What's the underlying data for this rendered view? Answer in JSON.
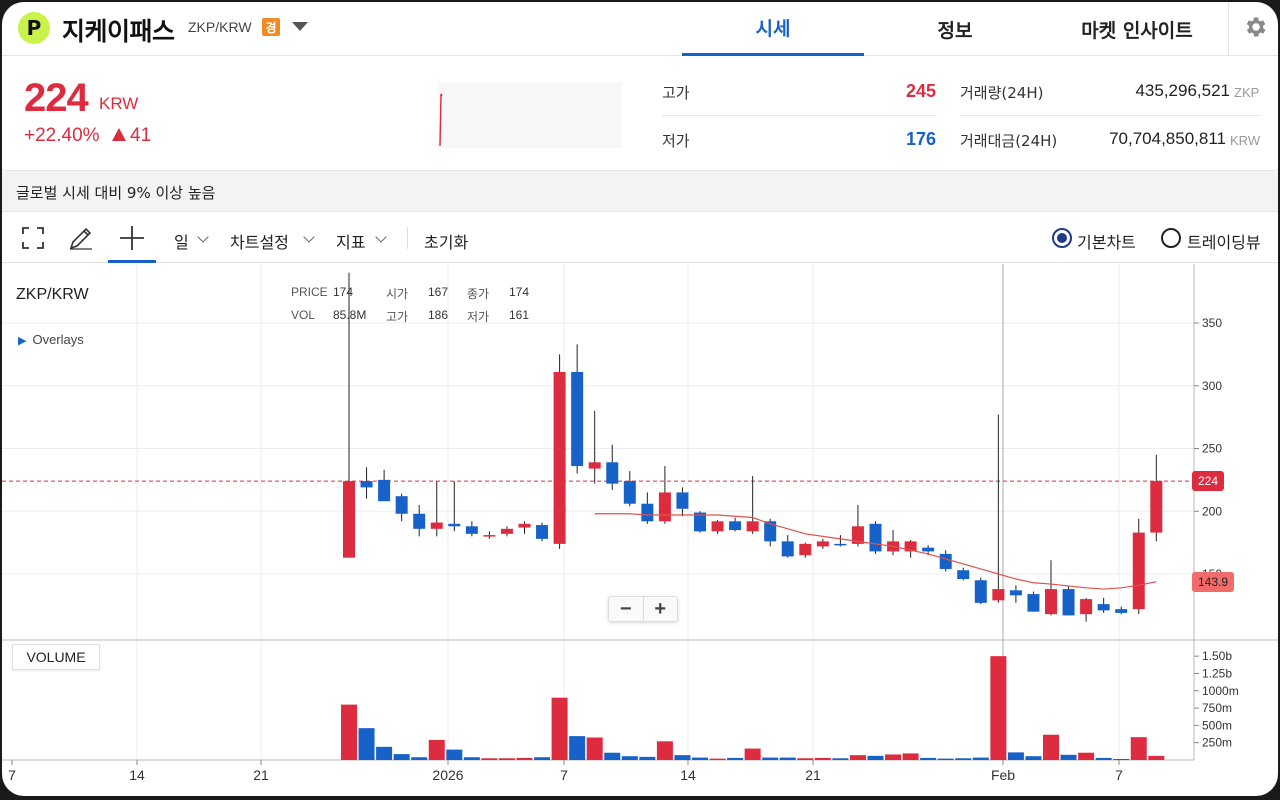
{
  "header": {
    "logo_letter": "P",
    "coin_name": "지케이패스",
    "pair": "ZKP/KRW",
    "warning_badge": "경",
    "tabs": [
      {
        "label": "시세",
        "active": true
      },
      {
        "label": "정보",
        "active": false
      },
      {
        "label": "마켓 인사이트",
        "active": false
      }
    ]
  },
  "price": {
    "current": "224",
    "unit": "KRW",
    "change_pct": "+22.40%",
    "change_abs": "41",
    "color_up": "#dd2c3f",
    "color_down": "#1662c9"
  },
  "stats": {
    "high_label": "고가",
    "high_value": "245",
    "low_label": "저가",
    "low_value": "176",
    "volume_label": "거래량(24H)",
    "volume_value": "435,296,521",
    "volume_unit": "ZKP",
    "amount_label": "거래대금(24H)",
    "amount_value": "70,704,850,811",
    "amount_unit": "KRW"
  },
  "notice": "글로벌 시세 대비 9% 이상 높음",
  "toolbar": {
    "icons": [
      "fullscreen-icon",
      "pencil-icon",
      "crosshair-icon"
    ],
    "interval": "일",
    "chart_settings": "차트설정",
    "indicators": "지표",
    "reset": "초기화",
    "radio_basic": "기본차트",
    "radio_trading": "트레이딩뷰"
  },
  "chart_header": {
    "symbol": "ZKP/KRW",
    "overlays": "Overlays",
    "price_label": "PRICE",
    "price_value": "174",
    "open_label": "시가",
    "open_value": "167",
    "close_label": "종가",
    "close_value": "174",
    "vol_label": "VOL",
    "vol_value": "85.8M",
    "high_label": "고가",
    "high_value": "186",
    "low_label": "저가",
    "low_value": "161"
  },
  "volume_label": "VOLUME",
  "zoom": {
    "minus": "−",
    "plus": "+"
  },
  "chart_data": {
    "type": "candlestick",
    "price_axis": {
      "ticks": [
        150,
        200,
        250,
        300,
        350
      ],
      "ylim": [
        130,
        390
      ]
    },
    "volume_axis": {
      "ticks": [
        "250m",
        "500m",
        "750m",
        "1000m",
        "1.25b",
        "1.50b"
      ]
    },
    "x_ticks": [
      "7",
      "14",
      "21",
      "2026",
      "7",
      "14",
      "21",
      "Feb",
      "7"
    ],
    "current_price_tag": "224",
    "ma_tag": "143.9",
    "candles": [
      {
        "o": 163,
        "h": 390,
        "l": 163,
        "c": 224,
        "v": 800
      },
      {
        "o": 224,
        "h": 235,
        "l": 210,
        "c": 219,
        "v": 460
      },
      {
        "o": 225,
        "h": 233,
        "l": 210,
        "c": 208,
        "v": 190
      },
      {
        "o": 212,
        "h": 214,
        "l": 192,
        "c": 198,
        "v": 85
      },
      {
        "o": 198,
        "h": 205,
        "l": 180,
        "c": 186,
        "v": 40
      },
      {
        "o": 186,
        "h": 224,
        "l": 180,
        "c": 191,
        "v": 290
      },
      {
        "o": 190,
        "h": 224,
        "l": 184,
        "c": 188,
        "v": 150
      },
      {
        "o": 188,
        "h": 192,
        "l": 180,
        "c": 182,
        "v": 40
      },
      {
        "o": 181,
        "h": 184,
        "l": 178,
        "c": 181,
        "v": 25
      },
      {
        "o": 182,
        "h": 188,
        "l": 180,
        "c": 186,
        "v": 25
      },
      {
        "o": 187,
        "h": 192,
        "l": 182,
        "c": 190,
        "v": 30
      },
      {
        "o": 189,
        "h": 191,
        "l": 176,
        "c": 178,
        "v": 40
      },
      {
        "o": 174,
        "h": 325,
        "l": 170,
        "c": 311,
        "v": 900
      },
      {
        "o": 311,
        "h": 333,
        "l": 230,
        "c": 236,
        "v": 345
      },
      {
        "o": 234,
        "h": 280,
        "l": 222,
        "c": 239,
        "v": 325
      },
      {
        "o": 239,
        "h": 253,
        "l": 217,
        "c": 222,
        "v": 105
      },
      {
        "o": 224,
        "h": 232,
        "l": 204,
        "c": 206,
        "v": 55
      },
      {
        "o": 206,
        "h": 215,
        "l": 190,
        "c": 192,
        "v": 45
      },
      {
        "o": 192,
        "h": 236,
        "l": 190,
        "c": 215,
        "v": 270
      },
      {
        "o": 215,
        "h": 219,
        "l": 196,
        "c": 202,
        "v": 70
      },
      {
        "o": 199,
        "h": 200,
        "l": 183,
        "c": 184,
        "v": 35
      },
      {
        "o": 184,
        "h": 193,
        "l": 182,
        "c": 192,
        "v": 20
      },
      {
        "o": 192,
        "h": 195,
        "l": 184,
        "c": 185,
        "v": 30
      },
      {
        "o": 184,
        "h": 228,
        "l": 182,
        "c": 192,
        "v": 165
      },
      {
        "o": 192,
        "h": 194,
        "l": 172,
        "c": 176,
        "v": 35
      },
      {
        "o": 176,
        "h": 181,
        "l": 163,
        "c": 164,
        "v": 35
      },
      {
        "o": 165,
        "h": 175,
        "l": 163,
        "c": 174,
        "v": 25
      },
      {
        "o": 172,
        "h": 178,
        "l": 170,
        "c": 176,
        "v": 30
      },
      {
        "o": 174,
        "h": 181,
        "l": 172,
        "c": 173,
        "v": 25
      },
      {
        "o": 174,
        "h": 205,
        "l": 172,
        "c": 188,
        "v": 70
      },
      {
        "o": 190,
        "h": 192,
        "l": 166,
        "c": 168,
        "v": 60
      },
      {
        "o": 168,
        "h": 185,
        "l": 165,
        "c": 176,
        "v": 80
      },
      {
        "o": 168,
        "h": 177,
        "l": 163,
        "c": 176,
        "v": 95
      },
      {
        "o": 171,
        "h": 173,
        "l": 165,
        "c": 168,
        "v": 30
      },
      {
        "o": 166,
        "h": 169,
        "l": 152,
        "c": 154,
        "v": 20
      },
      {
        "o": 153,
        "h": 155,
        "l": 145,
        "c": 146,
        "v": 25
      },
      {
        "o": 145,
        "h": 147,
        "l": 126,
        "c": 127,
        "v": 35
      },
      {
        "o": 129,
        "h": 277,
        "l": 127,
        "c": 138,
        "v": 1500
      },
      {
        "o": 137,
        "h": 141,
        "l": 127,
        "c": 133,
        "v": 110
      },
      {
        "o": 134,
        "h": 136,
        "l": 120,
        "c": 120,
        "v": 55
      },
      {
        "o": 118,
        "h": 161,
        "l": 117,
        "c": 138,
        "v": 365
      },
      {
        "o": 138,
        "h": 140,
        "l": 117,
        "c": 117,
        "v": 75
      },
      {
        "o": 118,
        "h": 131,
        "l": 112,
        "c": 130,
        "v": 105
      },
      {
        "o": 126,
        "h": 131,
        "l": 119,
        "c": 121,
        "v": 30
      },
      {
        "o": 122,
        "h": 124,
        "l": 118,
        "c": 119,
        "v": 15
      },
      {
        "o": 122,
        "h": 194,
        "l": 118,
        "c": 183,
        "v": 330
      },
      {
        "o": 183,
        "h": 245,
        "l": 176,
        "c": 224,
        "v": 60
      }
    ],
    "ma_line": [
      [
        14,
        198
      ],
      [
        15,
        198
      ],
      [
        16,
        198
      ],
      [
        17,
        197
      ],
      [
        18,
        197
      ],
      [
        19,
        197
      ],
      [
        20,
        197
      ],
      [
        21,
        197
      ],
      [
        22,
        196
      ],
      [
        23,
        195
      ],
      [
        24,
        190
      ],
      [
        25,
        186
      ],
      [
        26,
        182
      ],
      [
        27,
        180
      ],
      [
        28,
        178
      ],
      [
        29,
        176
      ],
      [
        30,
        174
      ],
      [
        31,
        172
      ],
      [
        32,
        169
      ],
      [
        33,
        166
      ],
      [
        34,
        162
      ],
      [
        35,
        158
      ],
      [
        36,
        154
      ],
      [
        37,
        150
      ],
      [
        38,
        146
      ],
      [
        39,
        143
      ],
      [
        40,
        142
      ],
      [
        41,
        140.5
      ],
      [
        42,
        139
      ],
      [
        43,
        138
      ],
      [
        44,
        139
      ],
      [
        45,
        141
      ],
      [
        46,
        143.9
      ]
    ]
  }
}
